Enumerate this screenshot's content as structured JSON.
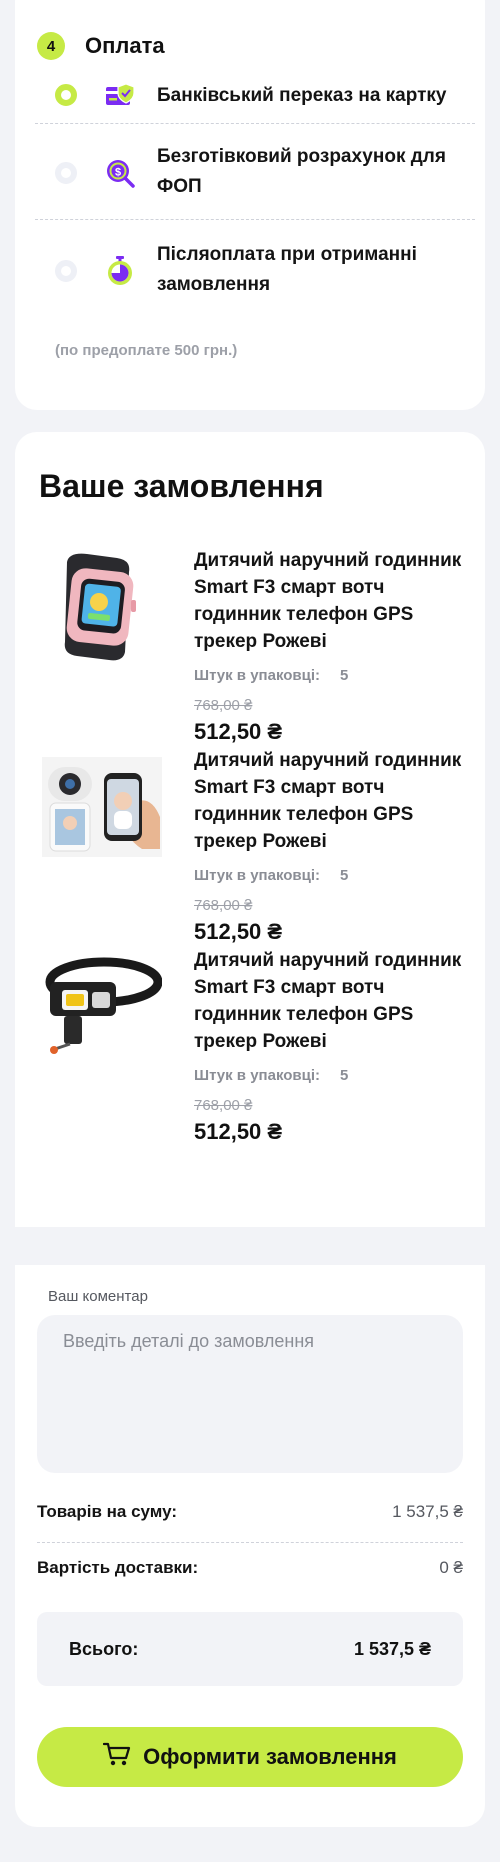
{
  "payment": {
    "step_number": "4",
    "title": "Оплата",
    "options": [
      {
        "label": "Банківський переказ на картку",
        "selected": true,
        "icon": "bank-card-shield-icon"
      },
      {
        "label": "Безготівковий розрахунок для ФОП",
        "selected": false,
        "icon": "coin-search-icon"
      },
      {
        "label": "Післяоплата при отриманні замовлення",
        "selected": false,
        "icon": "stopwatch-icon"
      }
    ],
    "note": "(по предоплате 500 грн.)"
  },
  "order": {
    "title": "Ваше замовлення",
    "products": [
      {
        "name": "Дитячий наручний годинник Smart F3 смарт вотч годинник телефон GPS трекер Рожеві",
        "qty_label": "Штук в упаковці:",
        "qty": "5",
        "old_price": "768,00 ₴",
        "price": "512,50 ₴",
        "image": "smartwatch-image"
      },
      {
        "name": "Дитячий наручний годинник Smart F3 смарт вотч годинник телефон GPS трекер Рожеві",
        "qty_label": "Штук в упаковці:",
        "qty": "5",
        "old_price": "768,00 ₴",
        "price": "512,50 ₴",
        "image": "baby-camera-image"
      },
      {
        "name": "Дитячий наручний годинник Smart F3 смарт вотч годинник телефон GPS трекер Рожеві",
        "qty_label": "Штук в упаковці:",
        "qty": "5",
        "old_price": "768,00 ₴",
        "price": "512,50 ₴",
        "image": "headlamp-image"
      }
    ]
  },
  "comment": {
    "label": "Ваш коментар",
    "placeholder": "Введіть деталі до замовлення",
    "value": ""
  },
  "totals": {
    "goods_label": "Товарів на суму:",
    "goods_value": "1 537,5 ₴",
    "delivery_label": "Вартість доставки:",
    "delivery_value": "0 ₴",
    "total_label": "Всього:",
    "total_value": "1 537,5 ₴"
  },
  "submit": {
    "label": "Оформити замовлення",
    "icon": "cart-icon"
  },
  "colors": {
    "accent": "#c6ea45",
    "icon_purple": "#7b2cf2",
    "background": "#f2f3f7"
  }
}
